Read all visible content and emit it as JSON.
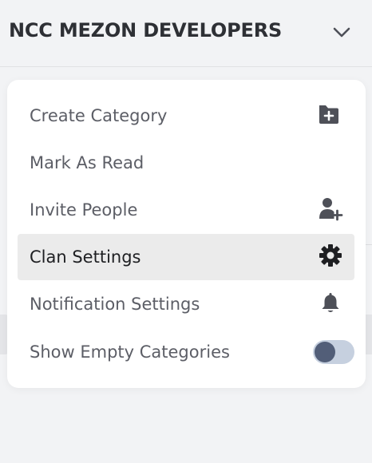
{
  "header": {
    "clan_name": "NCC MEZON DEVELOPERS",
    "expand_icon": "chevron-down-icon"
  },
  "menu": {
    "items": [
      {
        "label": "Create Category",
        "icon": "folder-plus-icon",
        "active": false
      },
      {
        "label": "Mark As Read",
        "icon": null,
        "active": false
      },
      {
        "label": "Invite People",
        "icon": "user-plus-icon",
        "active": false
      },
      {
        "label": "Clan Settings",
        "icon": "gear-icon",
        "active": true
      },
      {
        "label": "Notification Settings",
        "icon": "bell-icon",
        "active": false
      },
      {
        "label": "Show Empty Categories",
        "icon": "toggle",
        "active": false,
        "toggle_on": false
      }
    ]
  },
  "colors": {
    "background": "#f2f3f5",
    "menu_bg": "#ffffff",
    "active_row": "#ebebeb",
    "label": "#5c5e66",
    "icon": "#4e5058",
    "toggle_track": "#c6d0df",
    "toggle_knob": "#525e78"
  }
}
